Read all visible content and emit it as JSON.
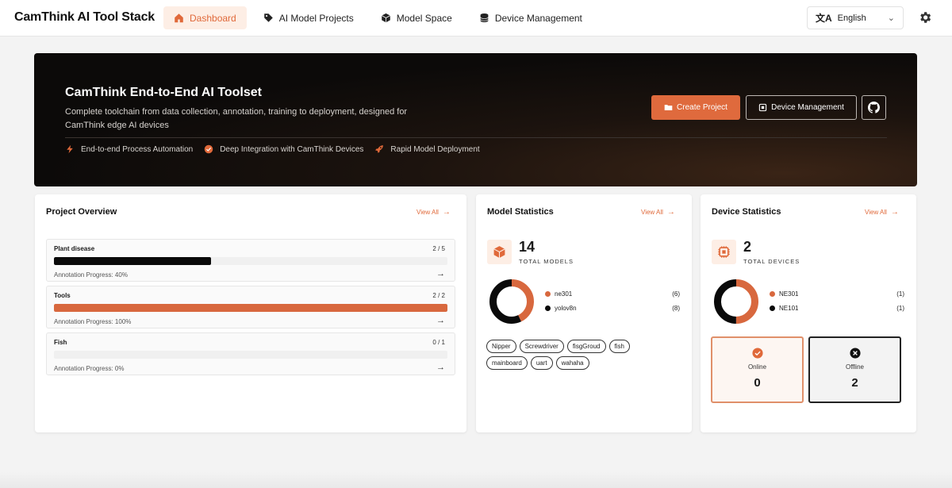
{
  "app": {
    "brand": "CamThink AI Tool Stack"
  },
  "nav": {
    "items": [
      {
        "label": "Dashboard",
        "icon": "home-icon",
        "active": true
      },
      {
        "label": "AI Model Projects",
        "icon": "tag-icon",
        "active": false
      },
      {
        "label": "Model Space",
        "icon": "cube-icon",
        "active": false
      },
      {
        "label": "Device Management",
        "icon": "database-icon",
        "active": false
      }
    ],
    "language": "English"
  },
  "hero": {
    "title": "CamThink End-to-End AI Toolset",
    "subtitle": "Complete toolchain from data collection, annotation, training to deployment, designed for CamThink edge AI devices",
    "features": [
      {
        "label": "End-to-end Process Automation",
        "icon": "bolt-icon"
      },
      {
        "label": "Deep Integration with CamThink Devices",
        "icon": "check-circle-icon"
      },
      {
        "label": "Rapid Model Deployment",
        "icon": "rocket-icon"
      }
    ],
    "create_label": "Create Project",
    "device_label": "Device Management"
  },
  "projects": {
    "title": "Project Overview",
    "view_all": "View All",
    "items": [
      {
        "name": "Plant disease",
        "count": "2 / 5",
        "progress_label": "Annotation Progress: 40%",
        "progress": 0.4,
        "color": "#0a0a0a"
      },
      {
        "name": "Tools",
        "count": "2 / 2",
        "progress_label": "Annotation Progress: 100%",
        "progress": 1.0,
        "color": "#d8683e"
      },
      {
        "name": "Fish",
        "count": "0 / 1",
        "progress_label": "Annotation Progress: 0%",
        "progress": 0.0,
        "color": "#d8683e"
      }
    ]
  },
  "models": {
    "title": "Model Statistics",
    "view_all": "View All",
    "total": "14",
    "total_label": "TOTAL MODELS",
    "legend": [
      {
        "name": "ne301",
        "count": "(6)",
        "value": 6,
        "color": "#d8683e"
      },
      {
        "name": "yolov8n",
        "count": "(8)",
        "value": 8,
        "color": "#0a0a0a"
      }
    ],
    "tags": [
      "Nipper",
      "Screwdriver",
      "fisgGroud",
      "fish",
      "mainboard",
      "uart",
      "wahaha"
    ]
  },
  "devices": {
    "title": "Device Statistics",
    "view_all": "View All",
    "total": "2",
    "total_label": "TOTAL DEVICES",
    "legend": [
      {
        "name": "NE301",
        "count": "(1)",
        "value": 1,
        "color": "#d8683e"
      },
      {
        "name": "NE101",
        "count": "(1)",
        "value": 1,
        "color": "#0a0a0a"
      }
    ],
    "online_label": "Online",
    "online_count": "0",
    "offline_label": "Offline",
    "offline_count": "2"
  }
}
